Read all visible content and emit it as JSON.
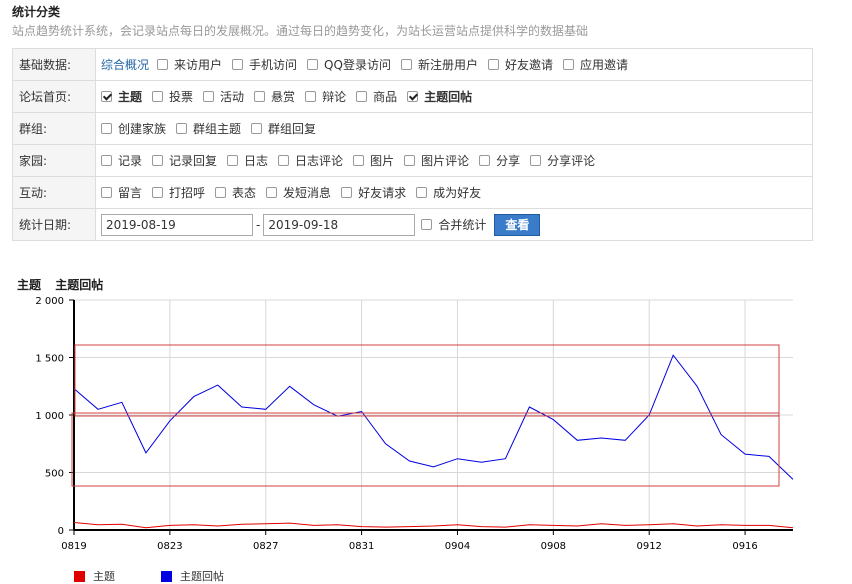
{
  "header": {
    "title": "统计分类",
    "subtitle": "站点趋势统计系统，会记录站点每日的发展概况。通过每日的趋势变化，为站长运营站点提供科学的数据基础"
  },
  "filters": {
    "rows": [
      {
        "label": "基础数据:",
        "link": "综合概况",
        "options": [
          {
            "label": "来访用户",
            "checked": false
          },
          {
            "label": "手机访问",
            "checked": false
          },
          {
            "label": "QQ登录访问",
            "checked": false
          },
          {
            "label": "新注册用户",
            "checked": false
          },
          {
            "label": "好友邀请",
            "checked": false
          },
          {
            "label": "应用邀请",
            "checked": false
          }
        ]
      },
      {
        "label": "论坛首页:",
        "options": [
          {
            "label": "主题",
            "checked": true
          },
          {
            "label": "投票",
            "checked": false
          },
          {
            "label": "活动",
            "checked": false
          },
          {
            "label": "悬赏",
            "checked": false
          },
          {
            "label": "辩论",
            "checked": false
          },
          {
            "label": "商品",
            "checked": false
          },
          {
            "label": "主题回帖",
            "checked": true
          }
        ]
      },
      {
        "label": "群组:",
        "options": [
          {
            "label": "创建家族",
            "checked": false
          },
          {
            "label": "群组主题",
            "checked": false
          },
          {
            "label": "群组回复",
            "checked": false
          }
        ]
      },
      {
        "label": "家园:",
        "options": [
          {
            "label": "记录",
            "checked": false
          },
          {
            "label": "记录回复",
            "checked": false
          },
          {
            "label": "日志",
            "checked": false
          },
          {
            "label": "日志评论",
            "checked": false
          },
          {
            "label": "图片",
            "checked": false
          },
          {
            "label": "图片评论",
            "checked": false
          },
          {
            "label": "分享",
            "checked": false
          },
          {
            "label": "分享评论",
            "checked": false
          }
        ]
      },
      {
        "label": "互动:",
        "options": [
          {
            "label": "留言",
            "checked": false
          },
          {
            "label": "打招呼",
            "checked": false
          },
          {
            "label": "表态",
            "checked": false
          },
          {
            "label": "发短消息",
            "checked": false
          },
          {
            "label": "好友请求",
            "checked": false
          },
          {
            "label": "成为好友",
            "checked": false
          }
        ]
      }
    ],
    "date_row": {
      "label": "统计日期:",
      "start": "2019-08-19",
      "separator": "-",
      "end": "2019-09-18",
      "merge_label": "合并统计",
      "merge_checked": false,
      "button": "查看"
    }
  },
  "chart_legend_top": [
    "主题",
    "主题回帖"
  ],
  "chart_data": {
    "type": "line",
    "ylim": [
      0,
      2000
    ],
    "yticks": [
      0,
      500,
      1000,
      1500,
      2000
    ],
    "ytick_labels": [
      "0",
      "500",
      "1 000",
      "1 500",
      "2 000"
    ],
    "xtick_labels": [
      "0819",
      "0823",
      "0827",
      "0831",
      "0904",
      "0908",
      "0912",
      "0916"
    ],
    "x": [
      "0819",
      "0820",
      "0821",
      "0822",
      "0823",
      "0824",
      "0825",
      "0826",
      "0827",
      "0828",
      "0829",
      "0830",
      "0831",
      "0901",
      "0902",
      "0903",
      "0904",
      "0905",
      "0906",
      "0907",
      "0908",
      "0909",
      "0910",
      "0911",
      "0912",
      "0913",
      "0914",
      "0915",
      "0916",
      "0917",
      "0918"
    ],
    "series": [
      {
        "name": "主题",
        "color": "#e00000",
        "values": [
          65,
          45,
          50,
          20,
          40,
          45,
          35,
          50,
          55,
          60,
          40,
          45,
          30,
          25,
          30,
          35,
          45,
          30,
          25,
          45,
          40,
          35,
          55,
          40,
          45,
          55,
          35,
          45,
          40,
          40,
          20
        ]
      },
      {
        "name": "主题回帖",
        "color": "#0000e0",
        "values": [
          1230,
          1050,
          1110,
          670,
          950,
          1160,
          1260,
          1070,
          1050,
          1250,
          1090,
          990,
          1030,
          750,
          600,
          550,
          620,
          590,
          620,
          1070,
          960,
          780,
          800,
          780,
          1000,
          1520,
          1250,
          830,
          660,
          640,
          440
        ]
      }
    ],
    "legend_position": "bottom-left"
  }
}
